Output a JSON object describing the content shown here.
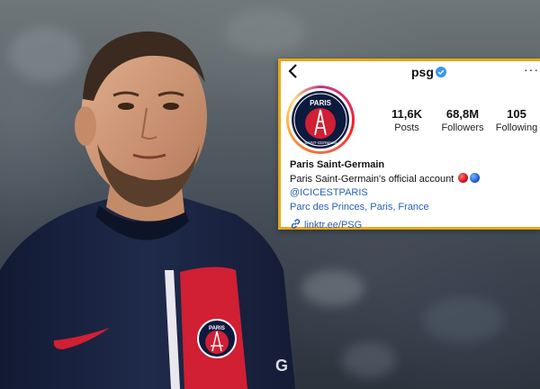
{
  "profile": {
    "username": "psg",
    "verified_icon": "verified-badge-icon",
    "avatar_logo_text": "PARIS",
    "avatar_logo_subtext": "SAINT-GERMAIN",
    "stats": [
      {
        "value": "11,6K",
        "label": "Posts"
      },
      {
        "value": "68,8M",
        "label": "Followers"
      },
      {
        "value": "105",
        "label": "Following"
      }
    ],
    "bio_name": "Paris Saint-Germain",
    "bio_text": "Paris Saint-Germain's official account",
    "bio_handle": "@ICICESTPARIS",
    "bio_location": "Parc des Princes, Paris, France",
    "link": "linktr.ee/PSG"
  },
  "jersey": {
    "crest_text": "PARIS",
    "crest_subtext": "SAINT-GERMAIN",
    "sponsor_fragment": "G"
  },
  "colors": {
    "card_border": "#e7a81c",
    "link_blue": "#2b5fae",
    "jersey_navy": "#1b2440",
    "jersey_red": "#d11f34"
  }
}
